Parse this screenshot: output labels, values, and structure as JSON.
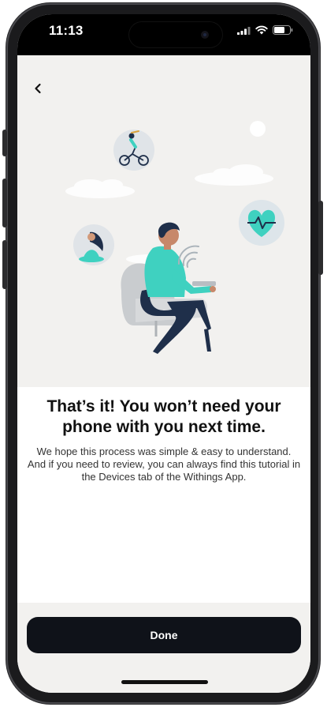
{
  "status_bar": {
    "time": "11:13",
    "signal_icon": "cellular-signal-icon",
    "wifi_icon": "wifi-icon",
    "battery_icon": "battery-icon"
  },
  "nav": {
    "back_icon": "chevron-left-icon"
  },
  "illustration": {
    "bicycle_icon": "cyclist-icon",
    "heart_icon": "heart-pulse-icon",
    "yoga_icon": "meditation-icon",
    "person": "person-sitting-in-chair",
    "signal": "wireless-signal-icon"
  },
  "main": {
    "title": "That’s it! You won’t need your phone with you next time.",
    "body": "We hope this process was simple & easy to understand. And if you need to review, you can always find this tutorial in the Devices tab of the Withings App."
  },
  "footer": {
    "done_label": "Done"
  },
  "colors": {
    "accent_teal": "#3fd1c0",
    "button_dark": "#0f1219",
    "illustration_bg": "#f2f1ef",
    "navy": "#1f2f4a"
  }
}
